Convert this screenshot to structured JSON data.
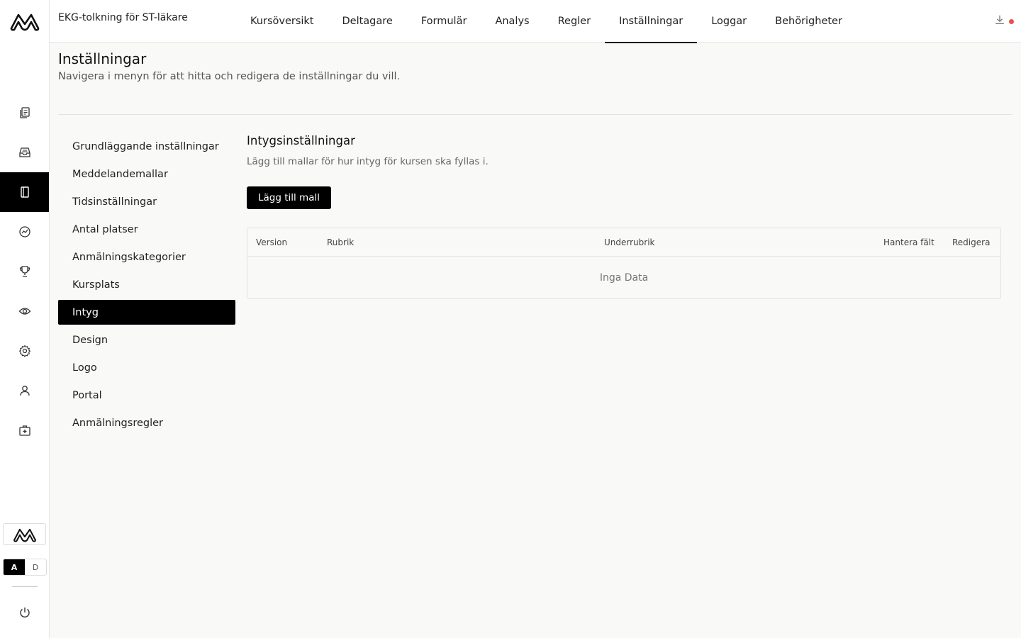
{
  "header": {
    "course_title": "EKG-tolkning för ST-läkare",
    "tabs": [
      {
        "label": "Kursöversikt",
        "active": false
      },
      {
        "label": "Deltagare",
        "active": false
      },
      {
        "label": "Formulär",
        "active": false
      },
      {
        "label": "Analys",
        "active": false
      },
      {
        "label": "Regler",
        "active": false
      },
      {
        "label": "Inställningar",
        "active": true
      },
      {
        "label": "Loggar",
        "active": false
      },
      {
        "label": "Behörigheter",
        "active": false
      }
    ]
  },
  "rail": {
    "icons": [
      "copy-icon",
      "inbox-icon",
      "notebook-icon",
      "analytics-icon",
      "trophy-icon",
      "eye-icon",
      "gear-icon",
      "user-icon",
      "medkit-icon"
    ],
    "active_index": 2,
    "lang": {
      "a": "A",
      "d": "D"
    }
  },
  "page": {
    "title": "Inställningar",
    "subtitle": "Navigera i menyn för att hitta och redigera de inställningar du vill."
  },
  "settings_menu": [
    {
      "label": "Grundläggande inställningar",
      "active": false
    },
    {
      "label": "Meddelandemallar",
      "active": false
    },
    {
      "label": "Tidsinställningar",
      "active": false
    },
    {
      "label": "Antal platser",
      "active": false
    },
    {
      "label": "Anmälningskategorier",
      "active": false
    },
    {
      "label": "Kursplats",
      "active": false
    },
    {
      "label": "Intyg",
      "active": true
    },
    {
      "label": "Design",
      "active": false
    },
    {
      "label": "Logo",
      "active": false
    },
    {
      "label": "Portal",
      "active": false
    },
    {
      "label": "Anmälningsregler",
      "active": false
    }
  ],
  "section": {
    "title": "Intygsinställningar",
    "subtitle": "Lägg till mallar för hur intyg för kursen ska fyllas i.",
    "add_button": "Lägg till mall"
  },
  "table": {
    "columns": {
      "version": "Version",
      "rubrik": "Rubrik",
      "underrubrik": "Underrubrik",
      "hantera": "Hantera fält",
      "redigera": "Redigera"
    },
    "empty_text": "Inga Data"
  },
  "colors": {
    "accent": "#000000",
    "notification": "#e5534b"
  }
}
